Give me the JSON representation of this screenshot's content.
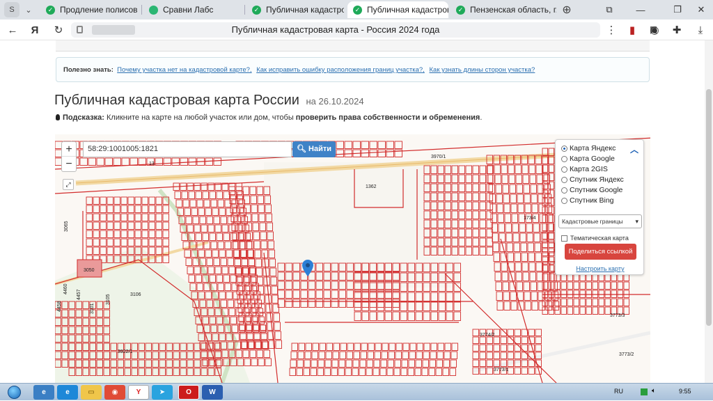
{
  "browser": {
    "tabs": [
      {
        "label": "Продление полисов Ипо",
        "active": false
      },
      {
        "label": "Сравни Лабс",
        "active": false
      },
      {
        "label": "Публичная кадастровая",
        "active": false
      },
      {
        "label": "Публичная кадастровая",
        "active": true
      },
      {
        "label": "Пензенская область, г. П",
        "active": false
      }
    ],
    "page_title": "Публичная кадастровая карта - Россия 2024 года"
  },
  "page": {
    "tips_label": "Полезно знать:",
    "tips_links": [
      "Почему участка нет на кадастровой карте?,",
      "Как исправить ошибку расположения границ участка?,",
      "Как узнать длины сторон участка?"
    ],
    "heading": "Публичная кадастровая карта России",
    "heading_date": "на 26.10.2024",
    "hint_label": "Подсказка:",
    "hint_text": "Кликните на карте на любой участок или дом, чтобы",
    "hint_bold": "проверить права собственности и обременения",
    "hint_end": "."
  },
  "map": {
    "search_value": "58:29:1001005:1821",
    "search_button": "Найти",
    "zoom_in": "+",
    "zoom_out": "−",
    "layers": [
      {
        "label": "Карта Яндекс",
        "selected": true
      },
      {
        "label": "Карта Google",
        "selected": false
      },
      {
        "label": "Карта 2GIS",
        "selected": false
      },
      {
        "label": "Спутник Яндекс",
        "selected": false
      },
      {
        "label": "Спутник Google",
        "selected": false
      },
      {
        "label": "Спутник Bing",
        "selected": false
      }
    ],
    "boundaries_select": "Кадастровые границы",
    "thematic_label": "Тематическая карта",
    "share_button": "Поделиться ссылкой",
    "configure_link": "Настроить карту",
    "labels": [
      "3970/1",
      "1362",
      "3065",
      "3050",
      "3106",
      "3101",
      "3105",
      "4460",
      "4457",
      "4458",
      "3922/1",
      "3773/3",
      "3774/2",
      "3773/1",
      "3773/2",
      "173/4",
      "13"
    ]
  },
  "taskbar": {
    "lang": "RU",
    "time": "9:55"
  },
  "colors": {
    "parcel_red": "#d22c2c",
    "share_red": "#d8453e",
    "search_blue": "#3f83c7",
    "marker_blue": "#2c7fd6"
  }
}
